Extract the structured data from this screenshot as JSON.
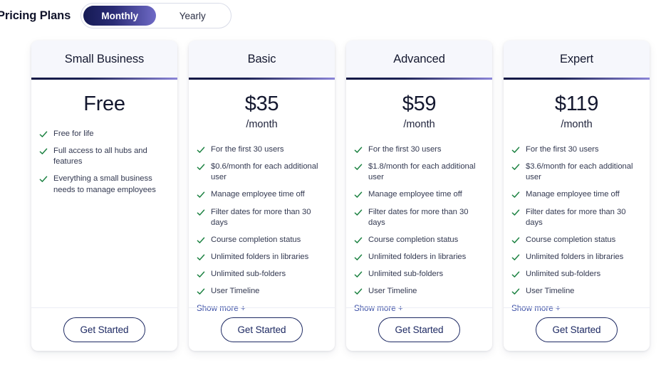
{
  "header": {
    "title": "Pricing Plans",
    "billing_toggle": {
      "options": [
        {
          "label": "Monthly",
          "active": true
        },
        {
          "label": "Yearly",
          "active": false
        }
      ],
      "active_gradient_from": "#151a54",
      "active_gradient_to": "#6f6ac6"
    }
  },
  "theme": {
    "accent_dark": "#121744",
    "accent_light": "#8b85d8",
    "check_green": "#19803f",
    "link_blue": "#3a4ea5",
    "cta_navy": "#1e2a63",
    "header_bg": "#f6f7fc",
    "page_bg": "#ffffff"
  },
  "cta_label": "Get Started",
  "show_more_label": "Show more +",
  "check_icon_name": "check-icon",
  "plans": [
    {
      "name": "Small Business",
      "price": "Free",
      "period": "",
      "has_period": false,
      "show_more": false,
      "features": [
        "Free for life",
        "Full access to all hubs and features",
        "Everything a small business needs to manage employees"
      ]
    },
    {
      "name": "Basic",
      "price": "$35",
      "period": "/month",
      "has_period": true,
      "show_more": true,
      "features": [
        "For the first 30 users",
        "$0.6/month for each additional user",
        "Manage employee time off",
        "Filter dates for more than 30 days",
        "Course completion status",
        "Unlimited folders in libraries",
        "Unlimited sub-folders",
        "User Timeline"
      ]
    },
    {
      "name": "Advanced",
      "price": "$59",
      "period": "/month",
      "has_period": true,
      "show_more": true,
      "features": [
        "For the first 30 users",
        "$1.8/month for each additional user",
        "Manage employee time off",
        "Filter dates for more than 30 days",
        "Course completion status",
        "Unlimited folders in libraries",
        "Unlimited sub-folders",
        "User Timeline"
      ]
    },
    {
      "name": "Expert",
      "price": "$119",
      "period": "/month",
      "has_period": true,
      "show_more": true,
      "features": [
        "For the first 30 users",
        "$3.6/month for each additional user",
        "Manage employee time off",
        "Filter dates for more than 30 days",
        "Course completion status",
        "Unlimited folders in libraries",
        "Unlimited sub-folders",
        "User Timeline"
      ]
    }
  ]
}
